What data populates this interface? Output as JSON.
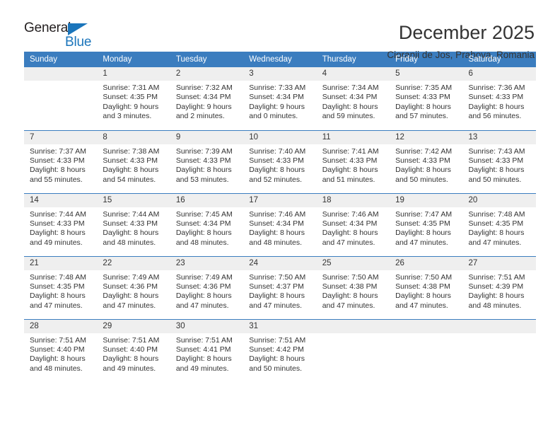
{
  "logo": {
    "word_one": "General",
    "word_two": "Blue",
    "triangle_color": "#1b75bb",
    "text_color": "#231f20"
  },
  "header": {
    "title": "December 2025",
    "location": "Cioranii de Jos, Prahova, Romania"
  },
  "theme": {
    "header_row_bg": "#3b7dbf",
    "daynum_bg": "#efefef",
    "text": "#333333"
  },
  "calendar": {
    "weekday_headers": [
      "Sunday",
      "Monday",
      "Tuesday",
      "Wednesday",
      "Thursday",
      "Friday",
      "Saturday"
    ],
    "weeks": [
      [
        {
          "day": "",
          "sunrise": "",
          "sunset": "",
          "daylight": "",
          "daylight2": ""
        },
        {
          "day": "1",
          "sunrise": "Sunrise: 7:31 AM",
          "sunset": "Sunset: 4:35 PM",
          "daylight": "Daylight: 9 hours",
          "daylight2": "and 3 minutes."
        },
        {
          "day": "2",
          "sunrise": "Sunrise: 7:32 AM",
          "sunset": "Sunset: 4:34 PM",
          "daylight": "Daylight: 9 hours",
          "daylight2": "and 2 minutes."
        },
        {
          "day": "3",
          "sunrise": "Sunrise: 7:33 AM",
          "sunset": "Sunset: 4:34 PM",
          "daylight": "Daylight: 9 hours",
          "daylight2": "and 0 minutes."
        },
        {
          "day": "4",
          "sunrise": "Sunrise: 7:34 AM",
          "sunset": "Sunset: 4:34 PM",
          "daylight": "Daylight: 8 hours",
          "daylight2": "and 59 minutes."
        },
        {
          "day": "5",
          "sunrise": "Sunrise: 7:35 AM",
          "sunset": "Sunset: 4:33 PM",
          "daylight": "Daylight: 8 hours",
          "daylight2": "and 57 minutes."
        },
        {
          "day": "6",
          "sunrise": "Sunrise: 7:36 AM",
          "sunset": "Sunset: 4:33 PM",
          "daylight": "Daylight: 8 hours",
          "daylight2": "and 56 minutes."
        }
      ],
      [
        {
          "day": "7",
          "sunrise": "Sunrise: 7:37 AM",
          "sunset": "Sunset: 4:33 PM",
          "daylight": "Daylight: 8 hours",
          "daylight2": "and 55 minutes."
        },
        {
          "day": "8",
          "sunrise": "Sunrise: 7:38 AM",
          "sunset": "Sunset: 4:33 PM",
          "daylight": "Daylight: 8 hours",
          "daylight2": "and 54 minutes."
        },
        {
          "day": "9",
          "sunrise": "Sunrise: 7:39 AM",
          "sunset": "Sunset: 4:33 PM",
          "daylight": "Daylight: 8 hours",
          "daylight2": "and 53 minutes."
        },
        {
          "day": "10",
          "sunrise": "Sunrise: 7:40 AM",
          "sunset": "Sunset: 4:33 PM",
          "daylight": "Daylight: 8 hours",
          "daylight2": "and 52 minutes."
        },
        {
          "day": "11",
          "sunrise": "Sunrise: 7:41 AM",
          "sunset": "Sunset: 4:33 PM",
          "daylight": "Daylight: 8 hours",
          "daylight2": "and 51 minutes."
        },
        {
          "day": "12",
          "sunrise": "Sunrise: 7:42 AM",
          "sunset": "Sunset: 4:33 PM",
          "daylight": "Daylight: 8 hours",
          "daylight2": "and 50 minutes."
        },
        {
          "day": "13",
          "sunrise": "Sunrise: 7:43 AM",
          "sunset": "Sunset: 4:33 PM",
          "daylight": "Daylight: 8 hours",
          "daylight2": "and 50 minutes."
        }
      ],
      [
        {
          "day": "14",
          "sunrise": "Sunrise: 7:44 AM",
          "sunset": "Sunset: 4:33 PM",
          "daylight": "Daylight: 8 hours",
          "daylight2": "and 49 minutes."
        },
        {
          "day": "15",
          "sunrise": "Sunrise: 7:44 AM",
          "sunset": "Sunset: 4:33 PM",
          "daylight": "Daylight: 8 hours",
          "daylight2": "and 48 minutes."
        },
        {
          "day": "16",
          "sunrise": "Sunrise: 7:45 AM",
          "sunset": "Sunset: 4:34 PM",
          "daylight": "Daylight: 8 hours",
          "daylight2": "and 48 minutes."
        },
        {
          "day": "17",
          "sunrise": "Sunrise: 7:46 AM",
          "sunset": "Sunset: 4:34 PM",
          "daylight": "Daylight: 8 hours",
          "daylight2": "and 48 minutes."
        },
        {
          "day": "18",
          "sunrise": "Sunrise: 7:46 AM",
          "sunset": "Sunset: 4:34 PM",
          "daylight": "Daylight: 8 hours",
          "daylight2": "and 47 minutes."
        },
        {
          "day": "19",
          "sunrise": "Sunrise: 7:47 AM",
          "sunset": "Sunset: 4:35 PM",
          "daylight": "Daylight: 8 hours",
          "daylight2": "and 47 minutes."
        },
        {
          "day": "20",
          "sunrise": "Sunrise: 7:48 AM",
          "sunset": "Sunset: 4:35 PM",
          "daylight": "Daylight: 8 hours",
          "daylight2": "and 47 minutes."
        }
      ],
      [
        {
          "day": "21",
          "sunrise": "Sunrise: 7:48 AM",
          "sunset": "Sunset: 4:35 PM",
          "daylight": "Daylight: 8 hours",
          "daylight2": "and 47 minutes."
        },
        {
          "day": "22",
          "sunrise": "Sunrise: 7:49 AM",
          "sunset": "Sunset: 4:36 PM",
          "daylight": "Daylight: 8 hours",
          "daylight2": "and 47 minutes."
        },
        {
          "day": "23",
          "sunrise": "Sunrise: 7:49 AM",
          "sunset": "Sunset: 4:36 PM",
          "daylight": "Daylight: 8 hours",
          "daylight2": "and 47 minutes."
        },
        {
          "day": "24",
          "sunrise": "Sunrise: 7:50 AM",
          "sunset": "Sunset: 4:37 PM",
          "daylight": "Daylight: 8 hours",
          "daylight2": "and 47 minutes."
        },
        {
          "day": "25",
          "sunrise": "Sunrise: 7:50 AM",
          "sunset": "Sunset: 4:38 PM",
          "daylight": "Daylight: 8 hours",
          "daylight2": "and 47 minutes."
        },
        {
          "day": "26",
          "sunrise": "Sunrise: 7:50 AM",
          "sunset": "Sunset: 4:38 PM",
          "daylight": "Daylight: 8 hours",
          "daylight2": "and 47 minutes."
        },
        {
          "day": "27",
          "sunrise": "Sunrise: 7:51 AM",
          "sunset": "Sunset: 4:39 PM",
          "daylight": "Daylight: 8 hours",
          "daylight2": "and 48 minutes."
        }
      ],
      [
        {
          "day": "28",
          "sunrise": "Sunrise: 7:51 AM",
          "sunset": "Sunset: 4:40 PM",
          "daylight": "Daylight: 8 hours",
          "daylight2": "and 48 minutes."
        },
        {
          "day": "29",
          "sunrise": "Sunrise: 7:51 AM",
          "sunset": "Sunset: 4:40 PM",
          "daylight": "Daylight: 8 hours",
          "daylight2": "and 49 minutes."
        },
        {
          "day": "30",
          "sunrise": "Sunrise: 7:51 AM",
          "sunset": "Sunset: 4:41 PM",
          "daylight": "Daylight: 8 hours",
          "daylight2": "and 49 minutes."
        },
        {
          "day": "31",
          "sunrise": "Sunrise: 7:51 AM",
          "sunset": "Sunset: 4:42 PM",
          "daylight": "Daylight: 8 hours",
          "daylight2": "and 50 minutes."
        },
        {
          "day": "",
          "sunrise": "",
          "sunset": "",
          "daylight": "",
          "daylight2": ""
        },
        {
          "day": "",
          "sunrise": "",
          "sunset": "",
          "daylight": "",
          "daylight2": ""
        },
        {
          "day": "",
          "sunrise": "",
          "sunset": "",
          "daylight": "",
          "daylight2": ""
        }
      ]
    ]
  }
}
